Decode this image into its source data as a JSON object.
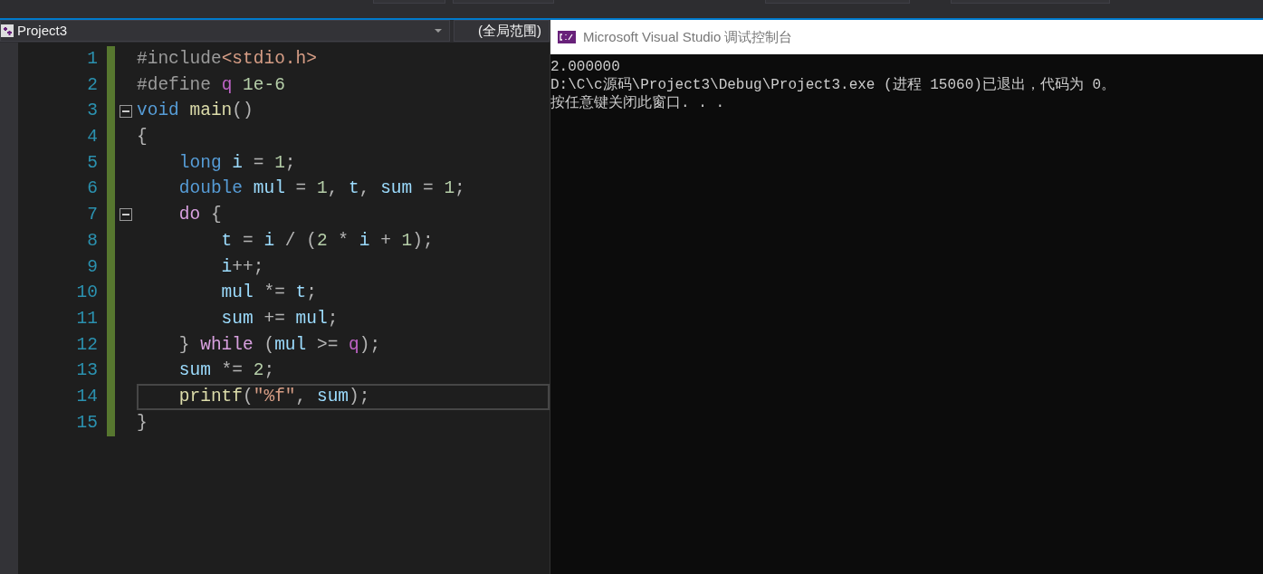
{
  "navigation_bar": {
    "project": "Project3",
    "scope": "(全局范围)"
  },
  "editor": {
    "lines": [
      {
        "number": "1",
        "current": false,
        "tokens": [
          {
            "kind": "preproc",
            "text": "#include"
          },
          {
            "kind": "string",
            "text": "<stdio.h>"
          }
        ]
      },
      {
        "number": "2",
        "current": false,
        "tokens": [
          {
            "kind": "preproc",
            "text": "#define "
          },
          {
            "kind": "macro",
            "text": "q"
          },
          {
            "kind": "number",
            "text": " 1e-6"
          }
        ]
      },
      {
        "number": "3",
        "fold": {
          "expanded": true
        },
        "current": false,
        "tokens": [
          {
            "kind": "keyword",
            "text": "void"
          },
          {
            "kind": "function",
            "text": " main"
          },
          {
            "kind": "punct",
            "text": "()"
          }
        ]
      },
      {
        "number": "4",
        "current": false,
        "tokens": [
          {
            "kind": "punct",
            "text": "{"
          }
        ]
      },
      {
        "number": "5",
        "current": false,
        "tokens": [
          {
            "kind": "keyword",
            "text": "    long"
          },
          {
            "kind": "variable",
            "text": " i"
          },
          {
            "kind": "punct",
            "text": " = "
          },
          {
            "kind": "number",
            "text": "1"
          },
          {
            "kind": "punct",
            "text": ";"
          }
        ]
      },
      {
        "number": "6",
        "current": false,
        "tokens": [
          {
            "kind": "keyword",
            "text": "    double"
          },
          {
            "kind": "variable",
            "text": " mul"
          },
          {
            "kind": "punct",
            "text": " = "
          },
          {
            "kind": "number",
            "text": "1"
          },
          {
            "kind": "punct",
            "text": ", "
          },
          {
            "kind": "variable",
            "text": "t"
          },
          {
            "kind": "punct",
            "text": ", "
          },
          {
            "kind": "variable",
            "text": "sum"
          },
          {
            "kind": "punct",
            "text": " = "
          },
          {
            "kind": "number",
            "text": "1"
          },
          {
            "kind": "punct",
            "text": ";"
          }
        ]
      },
      {
        "number": "7",
        "fold": {
          "expanded": true
        },
        "current": false,
        "tokens": [
          {
            "kind": "control",
            "text": "    do"
          },
          {
            "kind": "punct",
            "text": " {"
          }
        ]
      },
      {
        "number": "8",
        "current": false,
        "tokens": [
          {
            "kind": "variable",
            "text": "        t"
          },
          {
            "kind": "punct",
            "text": " = "
          },
          {
            "kind": "variable",
            "text": "i"
          },
          {
            "kind": "punct",
            "text": " / ("
          },
          {
            "kind": "number",
            "text": "2"
          },
          {
            "kind": "punct",
            "text": " * "
          },
          {
            "kind": "variable",
            "text": "i"
          },
          {
            "kind": "punct",
            "text": " + "
          },
          {
            "kind": "number",
            "text": "1"
          },
          {
            "kind": "punct",
            "text": ");"
          }
        ]
      },
      {
        "number": "9",
        "current": false,
        "tokens": [
          {
            "kind": "variable",
            "text": "        i"
          },
          {
            "kind": "punct",
            "text": "++;"
          }
        ]
      },
      {
        "number": "10",
        "current": false,
        "tokens": [
          {
            "kind": "variable",
            "text": "        mul"
          },
          {
            "kind": "punct",
            "text": " *= "
          },
          {
            "kind": "variable",
            "text": "t"
          },
          {
            "kind": "punct",
            "text": ";"
          }
        ]
      },
      {
        "number": "11",
        "current": false,
        "tokens": [
          {
            "kind": "variable",
            "text": "        sum"
          },
          {
            "kind": "punct",
            "text": " += "
          },
          {
            "kind": "variable",
            "text": "mul"
          },
          {
            "kind": "punct",
            "text": ";"
          }
        ]
      },
      {
        "number": "12",
        "current": false,
        "tokens": [
          {
            "kind": "punct",
            "text": "    } "
          },
          {
            "kind": "control",
            "text": "while"
          },
          {
            "kind": "punct",
            "text": " ("
          },
          {
            "kind": "variable",
            "text": "mul"
          },
          {
            "kind": "punct",
            "text": " >= "
          },
          {
            "kind": "macro",
            "text": "q"
          },
          {
            "kind": "punct",
            "text": ");"
          }
        ]
      },
      {
        "number": "13",
        "current": false,
        "tokens": [
          {
            "kind": "variable",
            "text": "    sum"
          },
          {
            "kind": "punct",
            "text": " *= "
          },
          {
            "kind": "number",
            "text": "2"
          },
          {
            "kind": "punct",
            "text": ";"
          }
        ]
      },
      {
        "number": "14",
        "current": true,
        "tokens": [
          {
            "kind": "function",
            "text": "    printf"
          },
          {
            "kind": "punct",
            "text": "("
          },
          {
            "kind": "string",
            "text": "\"%f\""
          },
          {
            "kind": "punct",
            "text": ", "
          },
          {
            "kind": "variable",
            "text": "sum"
          },
          {
            "kind": "punct",
            "text": ");"
          }
        ]
      },
      {
        "number": "15",
        "current": false,
        "tokens": [
          {
            "kind": "punct",
            "text": "}"
          }
        ]
      }
    ]
  },
  "console": {
    "title": "Microsoft Visual Studio 调试控制台",
    "lines": [
      "2.000000",
      "D:\\C\\c源码\\Project3\\Debug\\Project3.exe (进程 15060)已退出，代码为 0。",
      "按任意键关闭此窗口. . ."
    ]
  }
}
